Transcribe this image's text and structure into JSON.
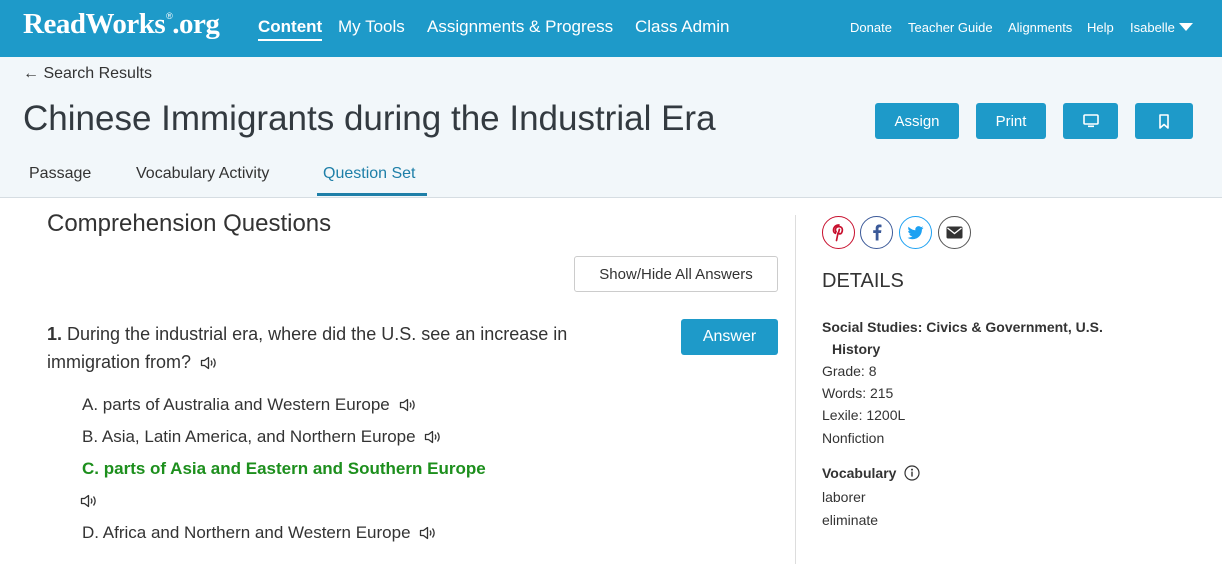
{
  "nav": {
    "logo_main": "ReadWorks",
    "logo_suffix": ".org",
    "logo_mark": "®",
    "links": [
      "Content",
      "My Tools",
      "Assignments & Progress",
      "Class Admin"
    ],
    "utility": [
      "Donate",
      "Teacher Guide",
      "Alignments",
      "Help"
    ],
    "user": "Isabelle"
  },
  "header": {
    "back_label": "← Search Results",
    "title": "Chinese Immigrants during the Industrial Era",
    "assign_label": "Assign",
    "print_label": "Print",
    "tabs": [
      "Passage",
      "Vocabulary Activity",
      "Question Set"
    ],
    "active_tab": "Question Set"
  },
  "main": {
    "section_title": "Comprehension Questions",
    "show_hide_label": "Show/Hide All Answers",
    "question": {
      "number": "1.",
      "text": "During the industrial era, where did the U.S. see an increase in immigration from?",
      "answer_label": "Answer",
      "choices": [
        {
          "letter": "A.",
          "text": "parts of Australia and Western Europe"
        },
        {
          "letter": "B.",
          "text": "Asia, Latin America, and Northern Europe"
        },
        {
          "letter": "C.",
          "text": "parts of Asia and Eastern and Southern Europe"
        },
        {
          "letter": "D.",
          "text": "Africa and Northern and Western Europe"
        }
      ],
      "correct_choice": "C"
    }
  },
  "sidebar": {
    "share_icons": [
      "pinterest-icon",
      "facebook-icon",
      "twitter-icon",
      "email-icon"
    ],
    "details_title": "DETAILS",
    "subject_line1": "Social Studies: Civics & Government, U.S.",
    "subject_line2": "History",
    "grade": "Grade: 8",
    "words": "Words: 215",
    "lexile": "Lexile: 1200L",
    "genre": "Nonfiction",
    "vocab_title": "Vocabulary",
    "vocab_words": [
      "laborer",
      "eliminate"
    ]
  },
  "colors": {
    "brand": "#1e9ac9",
    "active_tab": "#1e7fa8",
    "correct": "#1d8f1d",
    "header_bg": "#f2f7fa"
  }
}
